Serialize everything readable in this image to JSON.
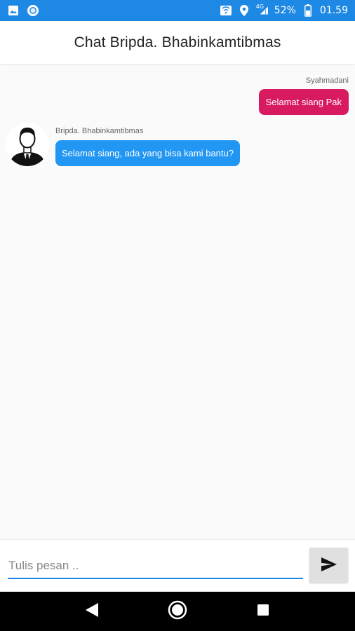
{
  "status_bar": {
    "battery_percent": "52%",
    "time": "01.59",
    "network_type": "4G",
    "icons": [
      "image-icon",
      "record-icon",
      "cast-icon",
      "location-icon",
      "signal-icon",
      "battery-icon"
    ]
  },
  "app_bar": {
    "title": "Chat Bripda. Bhabinkamtibmas"
  },
  "messages": [
    {
      "sender": "Syahmadani",
      "text": "Selamat siang Pak",
      "direction": "outgoing",
      "bubble_color": "#d81b60"
    },
    {
      "sender": "Bripda. Bhabinkamtibmas",
      "text": "Selamat siang, ada yang bisa kami bantu?",
      "direction": "incoming",
      "bubble_color": "#2196f3",
      "avatar": "officer-avatar-icon"
    }
  ],
  "composer": {
    "placeholder": "Tulis pesan ..",
    "value": "",
    "send_icon": "send-icon"
  },
  "nav_bar": {
    "icons": [
      "back-icon",
      "home-icon",
      "recents-icon"
    ]
  },
  "colors": {
    "primary": "#1e88e5",
    "outgoing_bubble": "#d81b60",
    "incoming_bubble": "#2196f3"
  }
}
